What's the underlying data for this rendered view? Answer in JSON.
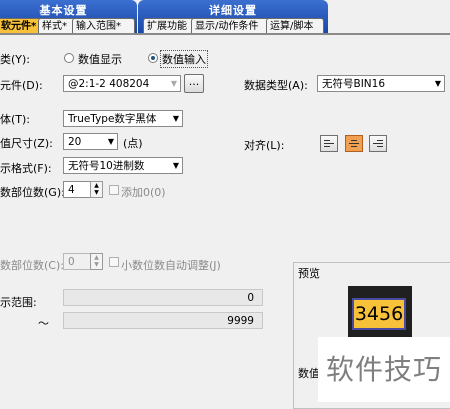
{
  "tabs": {
    "basic_group": "基本设置",
    "detail_group": "详细设置",
    "basic": [
      "软元件*",
      "样式*",
      "输入范围*"
    ],
    "detail": [
      "扩展功能",
      "显示/动作条件",
      "运算/脚本"
    ]
  },
  "type": {
    "label": "类(Y):",
    "options": [
      "数值显示",
      "数值输入"
    ],
    "selected": "数值输入"
  },
  "device": {
    "label": "元件(D):",
    "value": "@2:1-2 408204",
    "browse": "...",
    "data_type_label": "数据类型(A):",
    "data_type_value": "无符号BIN16"
  },
  "font": {
    "label": "体(T):",
    "value": "TrueType数字黑体"
  },
  "size": {
    "label": "值尺寸(Z):",
    "value": "20",
    "unit": "(点)"
  },
  "align": {
    "label": "对齐(L):",
    "selected": "center"
  },
  "format": {
    "label": "示格式(F):",
    "value": "无符号10进制数"
  },
  "int_digits": {
    "label": "数部位数(G):",
    "value": "4",
    "add_zero": "添加0(0)"
  },
  "frac_digits": {
    "label": "数部位数(C):",
    "value": "0",
    "auto_adjust": "小数位数自动调整(J)"
  },
  "range": {
    "label": "示范围:",
    "min": "0",
    "sep": "～",
    "max": "9999"
  },
  "preview": {
    "label": "预览",
    "value": "3456",
    "bottom_label": "数值"
  },
  "watermark": "软件技巧",
  "colors": {
    "tab_blue": "#1a47a8",
    "active_tab": "#f7c13a",
    "lamp_face": "#f7c13a"
  }
}
